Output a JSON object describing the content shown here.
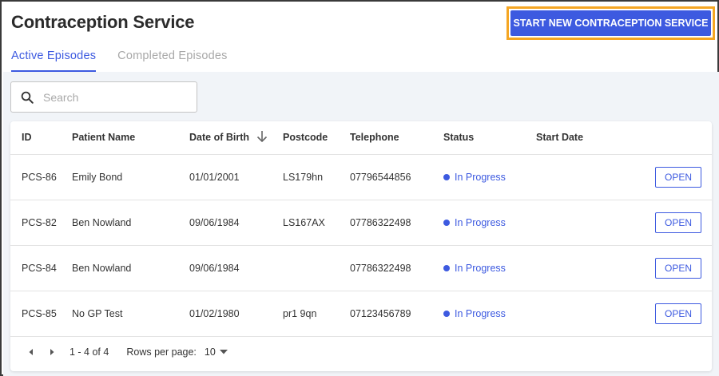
{
  "header": {
    "title": "Contraception Service",
    "start_button": "START NEW CONTRACEPTION SERVICE"
  },
  "tabs": [
    {
      "label": "Active Episodes",
      "active": true
    },
    {
      "label": "Completed Episodes",
      "active": false
    }
  ],
  "search": {
    "placeholder": "Search",
    "value": ""
  },
  "table": {
    "columns": [
      "ID",
      "Patient Name",
      "Date of Birth",
      "Postcode",
      "Telephone",
      "Status",
      "Start Date"
    ],
    "sorted_column": "Date of Birth",
    "sort_direction": "descending",
    "rows": [
      {
        "id": "PCS-86",
        "name": "Emily Bond",
        "dob": "01/01/2001",
        "postcode": "LS179hn",
        "telephone": "07796544856",
        "status": "In Progress",
        "start_date": "",
        "action": "OPEN"
      },
      {
        "id": "PCS-82",
        "name": "Ben Nowland",
        "dob": "09/06/1984",
        "postcode": "LS167AX",
        "telephone": "07786322498",
        "status": "In Progress",
        "start_date": "",
        "action": "OPEN"
      },
      {
        "id": "PCS-84",
        "name": "Ben Nowland",
        "dob": "09/06/1984",
        "postcode": "",
        "telephone": "07786322498",
        "status": "In Progress",
        "start_date": "",
        "action": "OPEN"
      },
      {
        "id": "PCS-85",
        "name": "No GP Test",
        "dob": "01/02/1980",
        "postcode": "pr1 9qn",
        "telephone": "07123456789",
        "status": "In Progress",
        "start_date": "",
        "action": "OPEN"
      }
    ]
  },
  "pagination": {
    "range": "1 - 4 of 4",
    "rows_per_page_label": "Rows per page:",
    "rows_per_page": "10"
  },
  "colors": {
    "accent": "#3d5ae0",
    "highlight_outline": "#f5a623",
    "status_in_progress": "#3d5ae0"
  },
  "icons": {
    "search": "search-icon",
    "sort": "arrow-down-icon",
    "prev": "chevron-left-icon",
    "next": "chevron-right-icon",
    "dropdown": "caret-down-icon"
  }
}
